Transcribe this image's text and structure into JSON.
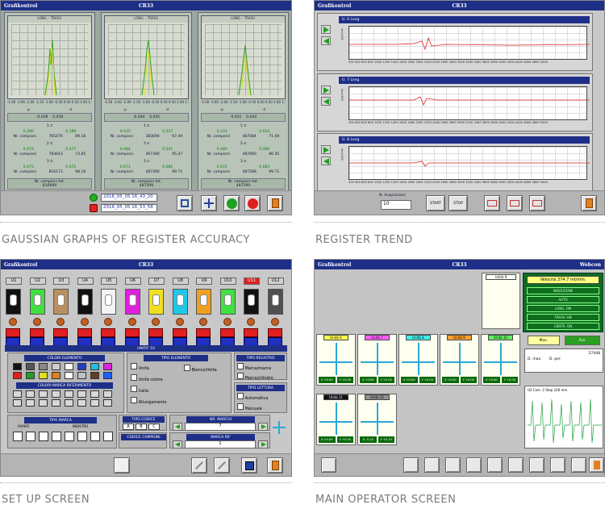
{
  "colors": {
    "title_bar": "#1e2f88",
    "panel_gray": "#c8c8c8",
    "green_accent": "#0e6e1e",
    "red_line": "#e02020"
  },
  "panel1": {
    "app": "Grafikontrol",
    "job": "CR33",
    "graph_header": "LONG. - TRASV.",
    "axis_ticks": "-1.00 -3.00 -2.00 -1.50 -1.00 -0.50 0.00 0.50 1.00 1.50 2.00 2.50 3.00 3.50 4.00 5.00",
    "axis_unit": "mm",
    "columns": [
      {
        "mu": "μ",
        "sigma": "σ",
        "v1": "-0.036",
        "v2": "0.058",
        "s1": "1 σ",
        "p1": "0.280",
        "p2": "0.189",
        "c1": "765476",
        "c2": "89.18",
        "s2": "2 σ",
        "p3": "0.473",
        "p4": "0.477",
        "c3": "783643",
        "c4": "73.85",
        "s3": "3 σ",
        "p5": "0.675",
        "p6": "0.672",
        "c5": "816173",
        "c6": "98.18",
        "tot": "Nr. campioni tot.",
        "tot_val": "816999"
      },
      {
        "mu": "μ",
        "sigma": "σ",
        "v1": "-0.044",
        "v2": "0.045",
        "s1": "1 σ",
        "p1": "0.635",
        "p2": "0.227",
        "c1": "383694",
        "c2": "67.49",
        "s2": "2 σ",
        "p3": "0.484",
        "p4": "0.501",
        "c3": "467380",
        "c4": "95.47",
        "s3": "3 σ",
        "p5": "0.671",
        "p6": "0.680",
        "c5": "487390",
        "c6": "99.71",
        "tot": "Nr. campioni tot.",
        "tot_val": "487599"
      },
      {
        "mu": "μ",
        "sigma": "σ",
        "v1": "-0.031",
        "v2": "0.044",
        "s1": "1 σ",
        "p1": "0.231",
        "p2": "0.014",
        "c1": "487084",
        "c2": "71.69",
        "s2": "2 σ",
        "p3": "0.480",
        "p4": "0.480",
        "c3": "487890",
        "c4": "96.45",
        "s3": "3 σ",
        "p5": "0.672",
        "p6": "0.683",
        "c5": "487289",
        "c6": "99.71",
        "tot": "Nr. campioni tot.",
        "tot_val": "487599"
      }
    ],
    "row_label": "Nr. campioni",
    "date_start": "2016_05_05 16_43_20",
    "date_end": "2016_05_05 16_53_58"
  },
  "panel2": {
    "app": "Grafikontrol",
    "job": "CR33",
    "trends": [
      {
        "label": "U. 6 Long",
        "ylabel": "mm/100"
      },
      {
        "label": "U. 7 Long",
        "ylabel": "mm/100"
      },
      {
        "label": "U. 8 Long",
        "ylabel": "mm/100"
      }
    ],
    "x_ticks": "200 400 600 800 1000 1200 1400 1600 1800 2000 2200 2400 2600 2800 3000 3200 3400 3600 3800 4000 4200 4400 4600 4800 5000",
    "acq_label": "N. Acquisizioni",
    "acq_value": "10",
    "start": "START",
    "stop": "STOP"
  },
  "panel3": {
    "app": "Grafikontrol",
    "job": "CR33",
    "units": [
      "U1",
      "U2",
      "U3",
      "U4",
      "U5",
      "U6",
      "U7",
      "U8",
      "U9",
      "U10",
      "U11",
      "U12"
    ],
    "unit_colors": [
      "#111111",
      "#40e040",
      "#b89060",
      "#111111",
      "#f4f4f4",
      "#e020e0",
      "#f0e020",
      "#20c8e8",
      "#f0a020",
      "#40e040",
      "#111111",
      "#505050"
    ],
    "unit_hdr": "UNITA' 10",
    "colori_elemento": "COLORI ELEMENTO",
    "colori_marca": "COLORI MARCA RIFERIMENTO",
    "tipo_elemento": "TIPO ELEMENTO",
    "opts": [
      "Unità",
      "Unità colore",
      "Cella",
      "Allungamento"
    ],
    "bianco": "Bianco/Volta",
    "tipo_registro": "TIPO REGISTRO",
    "reg_opts": [
      "Marca/marca",
      "Marca/cilindro"
    ],
    "tipo_lettura": "TIPO LETTURA",
    "let_opts": [
      "Automatica",
      "Manuale"
    ],
    "tipo_marca": "TIPO MARCA",
    "avanti": "AVANTI",
    "indietro": "INDIETRO",
    "tipo_codice": "TIPO CODICE",
    "codici": [
      "A",
      "B",
      "C"
    ],
    "codice_campioni": "CODICE CAMPIONI",
    "nr_marchi": "NR. MARCHI",
    "nr_marchi_val": "7",
    "marca_rif": "MARCA RIF",
    "marca_rif_val": "1"
  },
  "panel4": {
    "app": "Grafikontrol",
    "job": "CR33",
    "right_title": "Webcon",
    "unit_top": "Unità 9",
    "units_row1": [
      {
        "name": "Unità 6",
        "color": "#ffff50",
        "x": "X +0.00",
        "y": "Y +0.00"
      },
      {
        "name": "Unità 7",
        "color": "#ff60ff",
        "x": "X +0.00",
        "y": "Y +0.02"
      },
      {
        "name": "Unità 8",
        "color": "#40f0f0",
        "x": "X +0.00",
        "y": "Y +0.04"
      },
      {
        "name": "Unità 9",
        "color": "#ffa030",
        "x": "X +0.00",
        "y": "Y +0.00"
      },
      {
        "name": "Unità 10",
        "color": "#60f060",
        "x": "X +0.00",
        "y": "Y +0.00"
      }
    ],
    "units_row2": [
      {
        "name": "Unità 11",
        "color": "#111111",
        "x": "X +0.00",
        "y": "Y +0.00"
      },
      {
        "name": "Unità 12",
        "color": "#909090",
        "x": "X -5.13",
        "y": "Y +0.10"
      }
    ],
    "velocity": "Velocità 374.7 mt/min.",
    "modes": [
      "INSERZIONE",
      "AUTO",
      "LONG. ON",
      "TRASV. ON",
      "CENTR. ON"
    ],
    "man": "Man.",
    "aut": "Aut.",
    "d_max": "D. max.",
    "d_per": "D. per.",
    "d_val": "27448",
    "scope_label": "U2 Cam. 2 Step 100 mm"
  },
  "captions": {
    "c1": "GAUSSIAN GRAPHS OF REGISTER ACCURACY",
    "c2": "REGISTER TREND",
    "c3": "SET UP SCREEN",
    "c4": "MAIN OPERATOR SCREEN"
  }
}
